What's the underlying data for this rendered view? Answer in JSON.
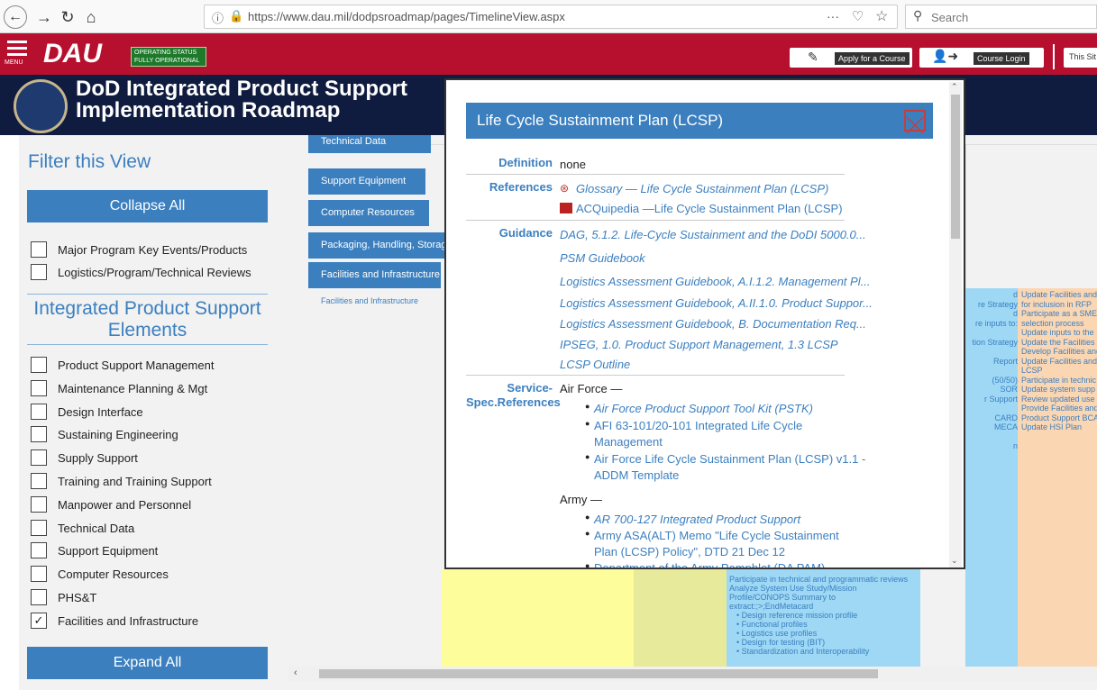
{
  "browser": {
    "url": "https://www.dau.mil/dodpsroadmap/pages/TimelineView.aspx",
    "url_host_bold": "dau.mil",
    "search_placeholder": "Search",
    "dots": "···"
  },
  "header": {
    "menu_label": "MENU",
    "logo": "DAU",
    "status_line1": "OPERATING STATUS",
    "status_line2": "FULLY OPERATIONAL",
    "apply": "Apply for a Course",
    "login": "Course Login",
    "this_site": "This Sit"
  },
  "banner": {
    "title_line1": "DoD Integrated Product Support",
    "title_line2": "Implementation Roadmap"
  },
  "filter": {
    "heading": "Filter this View",
    "collapse": "Collapse All",
    "expand": "Expand All",
    "top_items": [
      {
        "label": "Major Program Key Events/Products",
        "checked": false
      },
      {
        "label": "Logistics/Program/Technical Reviews",
        "checked": false
      }
    ],
    "ips_heading_1": "Integrated Product Support",
    "ips_heading_2": "Elements",
    "elements": [
      {
        "label": "Product Support Management",
        "checked": false
      },
      {
        "label": "Maintenance Planning & Mgt",
        "checked": false
      },
      {
        "label": "Design Interface",
        "checked": false
      },
      {
        "label": "Sustaining Engineering",
        "checked": false
      },
      {
        "label": "Supply Support",
        "checked": false
      },
      {
        "label": "Training and Training Support",
        "checked": false
      },
      {
        "label": "Manpower and Personnel",
        "checked": false
      },
      {
        "label": "Technical Data",
        "checked": false
      },
      {
        "label": "Support Equipment",
        "checked": false
      },
      {
        "label": "Computer Resources",
        "checked": false
      },
      {
        "label": "PHS&T",
        "checked": false
      },
      {
        "label": "Facilities and Infrastructure",
        "checked": true
      }
    ]
  },
  "timeline": {
    "categories": [
      "Technical Data",
      "Support Equipment",
      "Computer Resources",
      "Packaging, Handling, Storage",
      "Facilities and Infrastructure"
    ],
    "row_label": "Facilities and Infrastructure",
    "right_col_a": [
      "d",
      "re Strategy",
      "d",
      "re inputs to:",
      "",
      "tion Strategy",
      "",
      "Report",
      "",
      "(50/50)",
      "SOR",
      "r Support",
      "",
      "CARD",
      "MECA",
      "",
      "n"
    ],
    "right_col_b": [
      "Update Facilities and",
      "for inclusion in RFP",
      "Participate as a SME",
      "selection process",
      "Update inputs to the",
      "Update the Facilities",
      "Develop Facilities and",
      "Update Facilities and",
      "LCSP",
      "Participate in technic",
      "Update system supp",
      "Review updated use",
      "Provide Facilities and",
      "Product Support BCA",
      "Update HSI Plan"
    ],
    "blue_col": [
      "Participate in technical and programmatic reviews",
      "Analyze System Use Study/Mission",
      "Profile/CONOPS Summary to",
      "extract:;>;EndMetacard",
      "• Design reference mission profile",
      "• Functional profiles",
      "• Logistics use profiles",
      "• Design for testing (BIT)",
      "• Standardization and Interoperability"
    ]
  },
  "modal": {
    "title": "Life Cycle Sustainment Plan (LCSP)",
    "definition_label": "Definition",
    "definition": "none",
    "references_label": "References",
    "references": [
      "Glossary — Life Cycle Sustainment Plan (LCSP)",
      "ACQuipedia —Life Cycle Sustainment Plan (LCSP)"
    ],
    "guidance_label": "Guidance",
    "guidance": [
      "DAG, 5.1.2. Life-Cycle Sustainment and the DoDI 5000.0...",
      "PSM Guidebook",
      "Logistics Assessment Guidebook, A.I.1.2. Management Pl...",
      "Logistics Assessment Guidebook, A.II.1.0. Product Suppor...",
      "Logistics Assessment Guidebook, B. Documentation Req...",
      "IPSEG, 1.0. Product Support Management, 1.3 LCSP",
      "LCSP Outline"
    ],
    "service_label_1": "Service-",
    "service_label_2": "Spec.References",
    "af_heading": "Air Force —",
    "af_items": [
      "Air Force Product Support Tool Kit (PSTK)",
      "AFI 63-101/20-101 Integrated Life Cycle",
      "Management",
      "Air Force Life Cycle Sustainment Plan (LCSP) v1.1 -",
      "ADDM Template"
    ],
    "army_heading": "Army —",
    "army_items": [
      "AR 700-127 Integrated Product Support",
      "Army ASA(ALT) Memo \"Life Cycle Sustainment",
      "Plan (LCSP) Policy\", DTD 21 Dec 12",
      "Department of the Army Pamphlet (DA PAM)..."
    ]
  }
}
